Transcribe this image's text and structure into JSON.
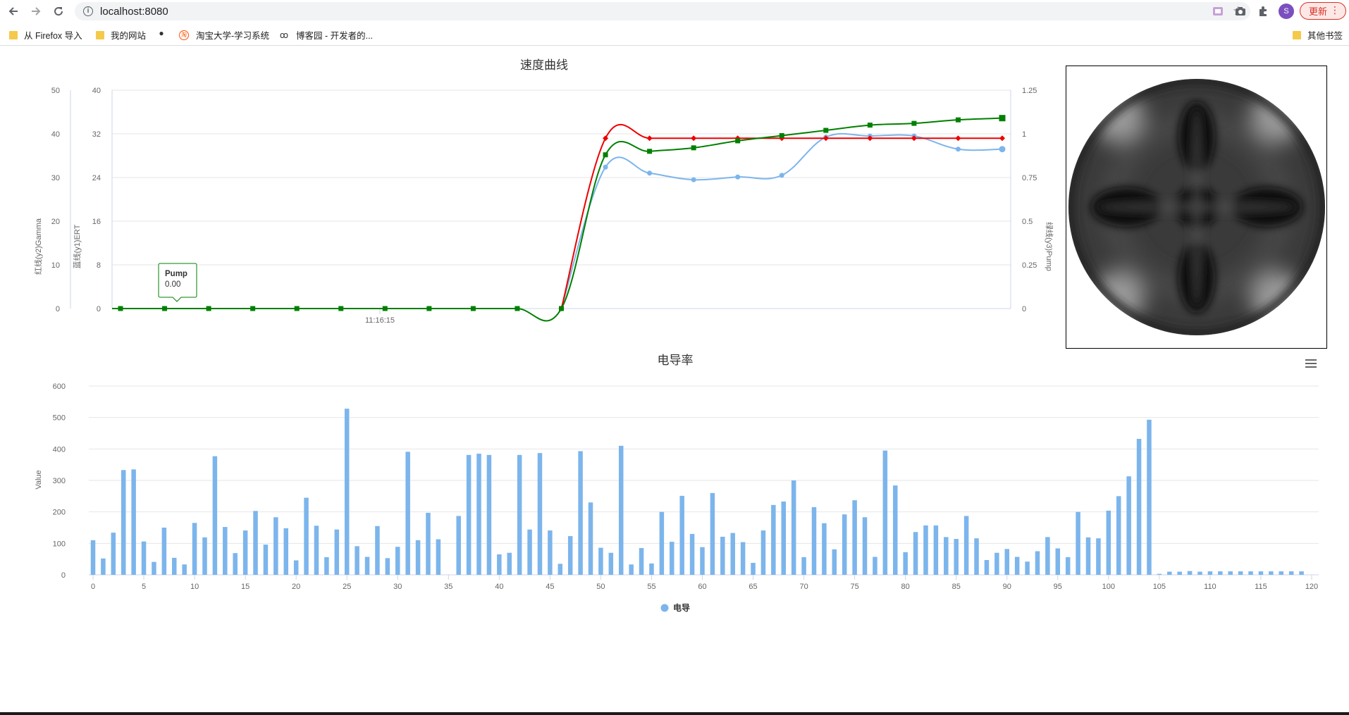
{
  "browser": {
    "url": "localhost:8080",
    "update_label": "更新",
    "profile_initial": "S",
    "icons": [
      "back-icon",
      "forward-icon",
      "reload-icon",
      "info-icon",
      "star-icon",
      "extension-icon",
      "camera-icon",
      "puzzle-icon",
      "menu-dots-icon"
    ],
    "bookmarks": [
      "从 Firefox 导入",
      "我的网站",
      "淘宝大学-学习系统",
      "博客园 - 开发者的...",
      "其他书签"
    ]
  },
  "speed_chart": {
    "title": "速度曲线",
    "y_left_outer_label": "红线(y2)Gamma",
    "y_left_inner_label": "蓝线(y1)ERT",
    "y_right_label": "绿线(y3)Pump",
    "x_tick_label": "11:16:15",
    "tooltip": {
      "series": "Pump",
      "value": "0.00"
    },
    "colors": {
      "gamma": "#ee0000",
      "ert": "#7cb5ec",
      "pump": "#008000"
    }
  },
  "conductivity_chart": {
    "title": "电导率",
    "ylabel": "Value",
    "legend": "电导",
    "menu_icon": "hamburger-menu-icon",
    "color": "#7cb5ec"
  },
  "chart_data": [
    {
      "type": "line",
      "title": "速度曲线",
      "x_tick_labels": [
        "11:16:15"
      ],
      "axes": {
        "y2_gamma": {
          "label": "红线(y2)Gamma",
          "ylim": [
            0,
            50
          ],
          "ticks": [
            0,
            10,
            20,
            30,
            40,
            50
          ]
        },
        "y1_ert": {
          "label": "蓝线(y1)ERT",
          "ylim": [
            0,
            40
          ],
          "ticks": [
            0,
            8,
            16,
            24,
            32,
            40
          ]
        },
        "y3_pump": {
          "label": "绿线(y3)Pump",
          "ylim": [
            0,
            1.25
          ],
          "ticks": [
            0,
            0.25,
            0.5,
            0.75,
            1,
            1.25
          ]
        }
      },
      "x": [
        0,
        1,
        2,
        3,
        4,
        5,
        6,
        7,
        8,
        9,
        10,
        11,
        12,
        13,
        14,
        15,
        16,
        17,
        18,
        19,
        20
      ],
      "series": [
        {
          "name": "Pump",
          "axis": "y3_pump",
          "color": "#008000",
          "marker": "square",
          "values": [
            0,
            0,
            0,
            0,
            0,
            0,
            0,
            0,
            0,
            0,
            0,
            0.88,
            0.9,
            0.92,
            0.96,
            0.99,
            1.02,
            1.05,
            1.06,
            1.08,
            1.09
          ]
        },
        {
          "name": "Gamma",
          "axis": "y2_gamma",
          "color": "#ee0000",
          "marker": "diamond",
          "values": [
            null,
            null,
            null,
            null,
            null,
            null,
            null,
            null,
            null,
            null,
            0,
            39,
            39,
            39,
            39,
            39,
            39,
            39,
            39,
            39,
            39
          ]
        },
        {
          "name": "ERT",
          "axis": "y1_ert",
          "color": "#7cb5ec",
          "marker": "circle",
          "values": [
            null,
            null,
            null,
            null,
            null,
            null,
            null,
            null,
            null,
            null,
            0,
            25.9,
            24.8,
            23.6,
            24.1,
            24.4,
            31.4,
            31.6,
            31.6,
            29.2,
            29.2
          ]
        }
      ],
      "tooltip": {
        "series": "Pump",
        "value": 0.0,
        "x_index": 1
      }
    },
    {
      "type": "bar",
      "title": "电导率",
      "ylabel": "Value",
      "xlabel": "",
      "ylim": [
        0,
        600
      ],
      "yticks": [
        0,
        100,
        200,
        300,
        400,
        500,
        600
      ],
      "xlim": [
        0,
        120
      ],
      "xticks": [
        0,
        5,
        10,
        15,
        20,
        25,
        30,
        35,
        40,
        45,
        50,
        55,
        60,
        65,
        70,
        75,
        80,
        85,
        90,
        95,
        100,
        105,
        110,
        115,
        120
      ],
      "legend": "top-center-below",
      "series": [
        {
          "name": "电导",
          "values": [
            110,
            52,
            134,
            333,
            335,
            106,
            41,
            150,
            54,
            33,
            165,
            119,
            377,
            152,
            69,
            141,
            203,
            96,
            183,
            148,
            46,
            245,
            156,
            56,
            144,
            528,
            91,
            57,
            155,
            53,
            89,
            391,
            110,
            197,
            113,
            0,
            187,
            381,
            385,
            381,
            65,
            70,
            381,
            144,
            387,
            141,
            35,
            123,
            393,
            230,
            86,
            70,
            410,
            33,
            85,
            36,
            200,
            105,
            251,
            130,
            88,
            260,
            121,
            133,
            104,
            38,
            141,
            222,
            233,
            300,
            56,
            215,
            164,
            81,
            192,
            237,
            183,
            57,
            395,
            284,
            72,
            136,
            157,
            157,
            120,
            114,
            187,
            116,
            47,
            70,
            82,
            57,
            42,
            75,
            120,
            84,
            56,
            200,
            119,
            116,
            204,
            250,
            313,
            432,
            493,
            3,
            10,
            10,
            12,
            10,
            11,
            11,
            11,
            11,
            11,
            11,
            11,
            11,
            11,
            11
          ]
        }
      ]
    }
  ]
}
